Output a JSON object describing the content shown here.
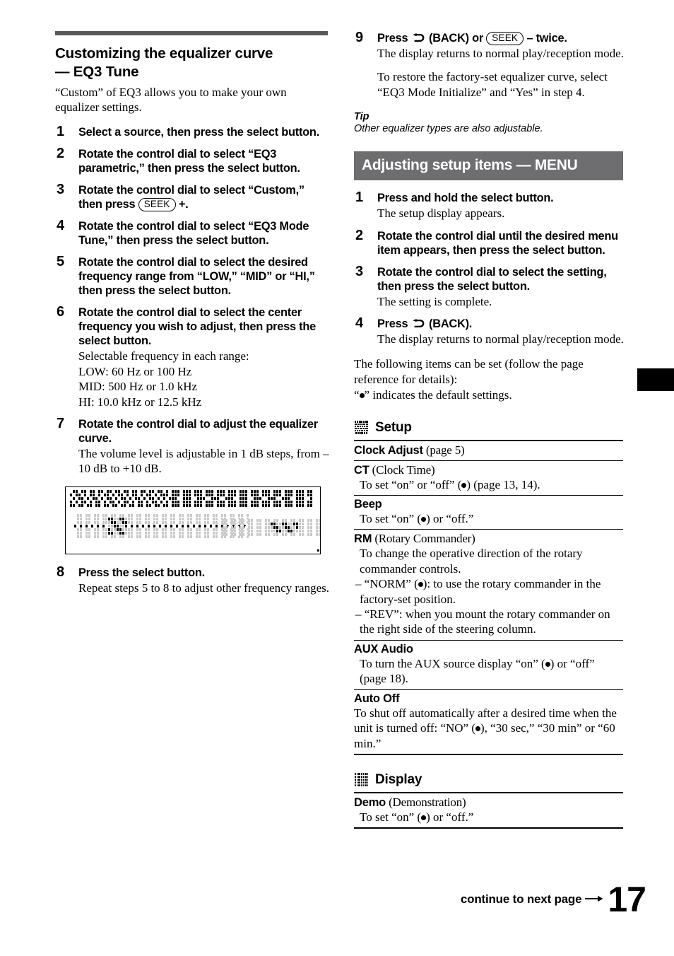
{
  "page": {
    "number": "17",
    "continue_text": "continue to next page",
    "continue_arrow_icon": "arrow-right-icon",
    "edge_tab_icon": "chapter-tab-marker"
  },
  "left_column": {
    "section_title_line1": "Customizing the equalizer curve",
    "section_title_line2": "— EQ3 Tune",
    "intro": "“Custom” of EQ3 allows you to make your own equalizer settings.",
    "steps": [
      {
        "num": "1",
        "title": "Select a source, then press the select button.",
        "body": ""
      },
      {
        "num": "2",
        "title": "Rotate the control dial to select “EQ3 parametric,” then press the select button.",
        "body": ""
      },
      {
        "num": "3",
        "title_pre": "Rotate the control dial to select “Custom,” then press ",
        "seek_label": "SEEK",
        "title_post": " +.",
        "num_3": "3"
      },
      {
        "num": "4",
        "title": "Rotate the control dial to select “EQ3 Mode Tune,” then press the select button.",
        "body": ""
      },
      {
        "num": "5",
        "title": "Rotate the control dial to select the desired frequency range from “LOW,” “MID” or “HI,” then press the select button.",
        "body": ""
      },
      {
        "num": "6",
        "title": "Rotate the control dial to select the center frequency you wish to adjust, then press the select button.",
        "body_line1": "Selectable frequency in each range:",
        "body_line2": "LOW: 60 Hz or 100 Hz",
        "body_line3": "MID: 500 Hz or 1.0 kHz",
        "body_line4": "HI: 10.0 kHz or 12.5 kHz"
      },
      {
        "num": "7",
        "title": "Rotate the control dial to adjust the equalizer curve.",
        "body": "The volume level is adjustable in 1 dB steps, from –10 dB to +10 dB."
      },
      {
        "num": "8",
        "title": "Press the select button.",
        "body": "Repeat steps 5 to 8 to adjust other frequency ranges."
      }
    ],
    "lcd_figure_name": "lcd-display-illustration"
  },
  "right_column": {
    "step9": {
      "num": "9",
      "title_pre": "Press ",
      "back_icon": "back-arrow-icon",
      "title_mid": " (BACK) or ",
      "seek_label": "SEEK",
      "title_post": " – twice.",
      "body1": "The display returns to normal play/reception mode.",
      "body2": "To restore the factory-set equalizer curve, select “EQ3 Mode Initialize” and “Yes” in step 4."
    },
    "tip": {
      "label": "Tip",
      "text": "Other equalizer types are also adjustable."
    },
    "banner_title": "Adjusting setup items — MENU",
    "menu_steps": [
      {
        "num": "1",
        "title": "Press and hold the select button.",
        "body": "The setup display appears."
      },
      {
        "num": "2",
        "title": "Rotate the control dial until the desired menu item appears, then press the select button.",
        "body": ""
      },
      {
        "num": "3",
        "title": "Rotate the control dial to select the setting, then press the select button.",
        "body": "The setting is complete."
      },
      {
        "num": "4",
        "title_pre": "Press ",
        "back_icon": "back-arrow-icon",
        "title_post": " (BACK).",
        "body": "The display returns to normal play/reception mode."
      }
    ],
    "following_items_text": "The following items can be set (follow the page reference for details):",
    "default_note_pre": "“",
    "default_note_post": "” indicates the default settings.",
    "categories": [
      {
        "icon": "setup-matrix-icon",
        "label": "Setup",
        "items": [
          {
            "name": "Clock Adjust",
            "paren": " (page 5)",
            "desc": ""
          },
          {
            "name": "CT",
            "paren": " (Clock Time)",
            "desc_pre": "To set “on” or “off” (",
            "desc_post": ") (page 13, 14)."
          },
          {
            "name": "Beep",
            "paren": "",
            "desc_pre": "To set “on” (",
            "desc_post": ") or “off.”"
          },
          {
            "name": "RM",
            "paren": " (Rotary Commander)",
            "desc": "To change the operative direction of the rotary commander controls.",
            "sub_pre": "– “NORM” (",
            "sub_post": "): to use the rotary commander in the factory-set position.",
            "sub2": "– “REV”: when you mount the rotary commander on the right side of the steering column."
          },
          {
            "name": "AUX Audio",
            "paren": "",
            "desc_pre": "To turn the AUX source display “on” (",
            "desc_post": ") or “off” (page 18)."
          },
          {
            "name": "Auto Off",
            "paren": "",
            "desc_pre": "To shut off automatically after a desired time when the unit is turned off: “NO” (",
            "desc_post": "), “30 sec,” “30 min” or “60 min.”"
          }
        ]
      },
      {
        "icon": "display-matrix-icon",
        "label": "Display",
        "items": [
          {
            "name": "Demo",
            "paren": " (Demonstration)",
            "desc_pre": "To set “on” (",
            "desc_post": ") or “off.”"
          }
        ]
      }
    ]
  },
  "colors": {
    "rule_gray": "#58585a",
    "banner_gray": "#6e6e70",
    "text": "#000000",
    "background": "#ffffff"
  }
}
